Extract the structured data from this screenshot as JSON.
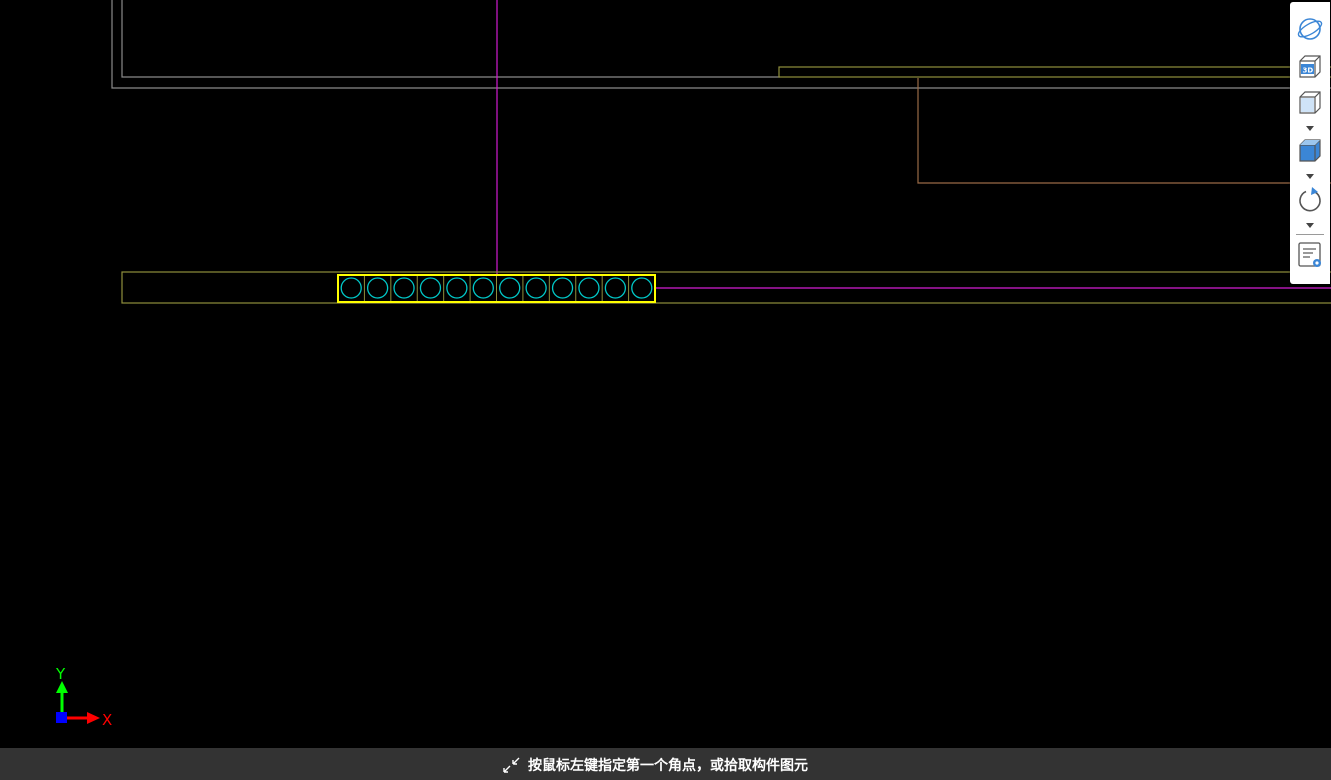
{
  "status_bar": {
    "message": "按鼠标左键指定第一个角点，或拾取构件图元",
    "icon": "pick-arrows-icon"
  },
  "axis_indicator": {
    "x_label": "X",
    "y_label": "Y",
    "x_color": "#ff0000",
    "y_color": "#00ff00",
    "origin_color": "#0000ff"
  },
  "view_toolbar": {
    "buttons": [
      {
        "id": "orbit",
        "icon": "orbit-icon",
        "has_dropdown": false
      },
      {
        "id": "view-3d",
        "icon": "3d-view-cube-icon",
        "has_dropdown": false
      },
      {
        "id": "view-cube",
        "icon": "view-cube-icon",
        "has_dropdown": true
      },
      {
        "id": "shading",
        "icon": "shaded-cube-icon",
        "has_dropdown": true
      },
      {
        "id": "rotate",
        "icon": "rotate-icon",
        "has_dropdown": true
      },
      {
        "id": "display-settings",
        "icon": "display-settings-icon",
        "has_dropdown": false
      }
    ],
    "icon_color": "#3b86d6"
  },
  "drawing": {
    "background": "#000000",
    "rebar_count": 12,
    "colors": {
      "beam_outline": "#8f8f3c",
      "wall_outline": "#8a8a8a",
      "highlight_box": "#ffff00",
      "rebar_circle": "#00c8c8",
      "magenta_line": "#d21cd2",
      "brown_line": "#9a6a46"
    }
  }
}
